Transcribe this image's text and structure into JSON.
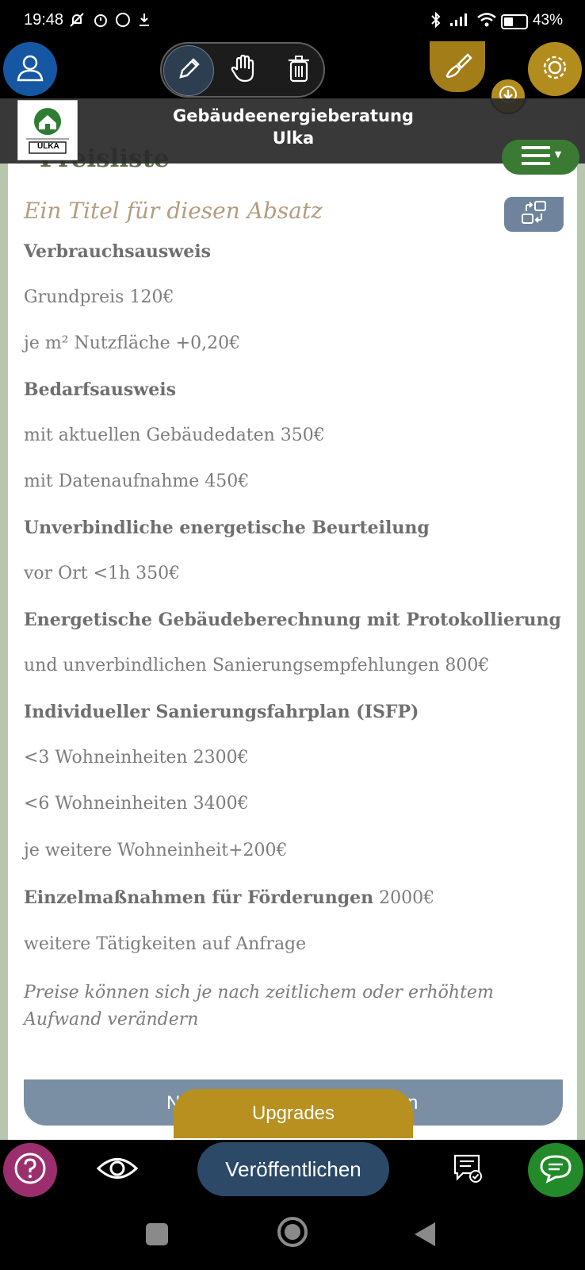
{
  "status_bar": {
    "time": "19:48",
    "battery": "43%",
    "icons": [
      "no-notifications-icon",
      "alarm-icon",
      "whatsapp-icon",
      "download-status-icon",
      "bluetooth-icon",
      "signal-icon",
      "wifi-icon",
      "battery-icon"
    ]
  },
  "toolbar": {
    "icons": [
      "user-icon",
      "pencil-icon",
      "hand-icon",
      "trash-icon",
      "brush-icon",
      "download-icon",
      "gear-icon"
    ]
  },
  "header": {
    "title_line1": "Gebäudeenergieberatung",
    "title_line2": "Ulka",
    "logo_text": "ULKA",
    "menu_icon": "hamburger-icon"
  },
  "section": {
    "heading": "Preisliste",
    "paragraph_title": "Ein Titel für diesen Absatz"
  },
  "price_list": [
    {
      "text": "Verbrauchsausweis",
      "style": "bold"
    },
    {
      "text": "Grundpreis 120€",
      "style": "normal"
    },
    {
      "text": "je m² Nutzfläche +0,20€",
      "style": "normal"
    },
    {
      "text": "Bedarfsausweis",
      "style": "bold"
    },
    {
      "text": "mit aktuellen Gebäudedaten 350€",
      "style": "normal"
    },
    {
      "text": "mit Datenaufnahme 450€",
      "style": "normal"
    },
    {
      "text": "Unverbindliche energetische Beurteilung",
      "style": "bold"
    },
    {
      "text": "vor Ort <1h 350€",
      "style": "normal"
    },
    {
      "text": "Energetische Gebäudeberechnung mit Protokollierung",
      "style": "bold"
    },
    {
      "text": "und unverbindlichen Sanierungsempfehlungen 800€",
      "style": "normal"
    },
    {
      "text": "Individueller Sanierungsfahrplan (ISFP)",
      "style": "bold"
    },
    {
      "text": "<3 Wohneinheiten 2300€",
      "style": "normal"
    },
    {
      "text": "<6 Wohneinheiten 3400€",
      "style": "normal"
    },
    {
      "text": "je weitere Wohneinheit+200€",
      "style": "normal"
    }
  ],
  "single_measures": {
    "bold": "Einzelmaßnahmen für Förderungen",
    "price": " 2000€"
  },
  "further": "weitere Tätigkeiten auf Anfrage",
  "note": "Preise können sich je nach zeitlichem oder erhöhtem Aufwand verändern",
  "next_button": {
    "left": "N",
    "right": "n"
  },
  "upgrades_label": "Upgrades",
  "bottom_bar": {
    "publish_label": "Veröffentlichen",
    "icons": [
      "help-icon",
      "eye-icon",
      "review-icon",
      "chat-icon"
    ]
  },
  "colors": {
    "accent_gold": "#b8901f",
    "primary_blue": "#2c4a67",
    "green": "#3a7a33",
    "help_purple": "#9b2f6e"
  }
}
